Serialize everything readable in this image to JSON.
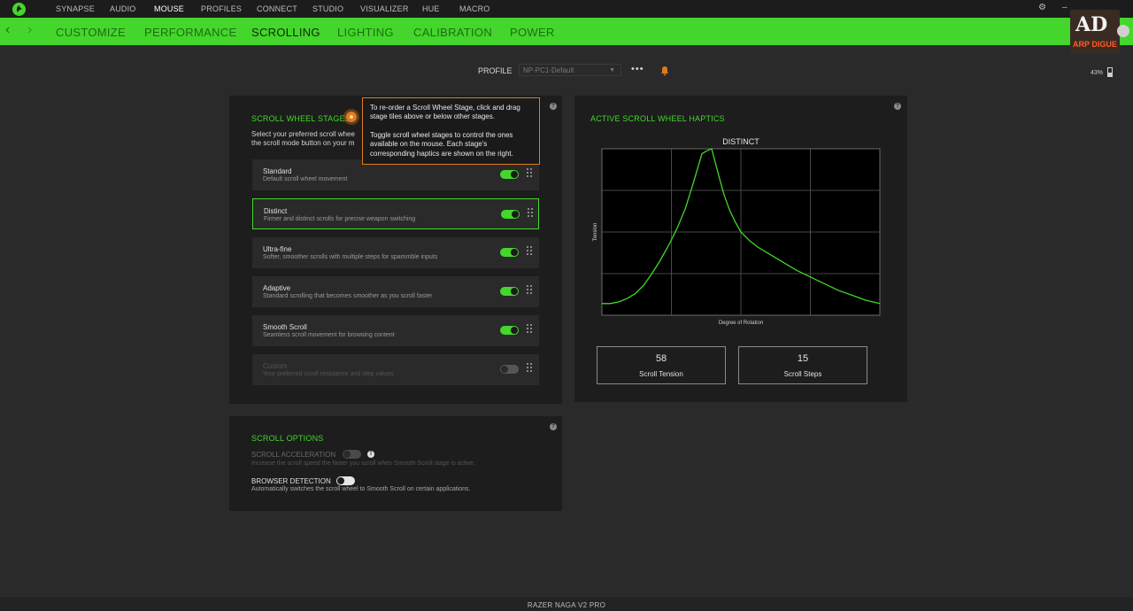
{
  "topnav": {
    "items": [
      {
        "label": "SYNAPSE"
      },
      {
        "label": "AUDIO"
      },
      {
        "label": "MOUSE"
      },
      {
        "label": "PROFILES"
      },
      {
        "label": "CONNECT"
      },
      {
        "label": "STUDIO"
      },
      {
        "label": "VISUALIZER"
      },
      {
        "label": "HUE"
      },
      {
        "label": "MACRO"
      }
    ],
    "active": "MOUSE"
  },
  "subnav": {
    "items": [
      {
        "label": "CUSTOMIZE"
      },
      {
        "label": "PERFORMANCE"
      },
      {
        "label": "SCROLLING"
      },
      {
        "label": "LIGHTING"
      },
      {
        "label": "CALIBRATION"
      },
      {
        "label": "POWER"
      }
    ],
    "active": "SCROLLING"
  },
  "watermark": {
    "big": "AD",
    "small": "ARP DIGUE"
  },
  "profile": {
    "label": "PROFILE",
    "value": "NP-PC1-Default",
    "more": "•••"
  },
  "battery": {
    "percent": "43%"
  },
  "stages_panel": {
    "title": "SCROLL WHEEL STAGES",
    "description_line1": "Select your preferred scroll whee",
    "description_line2": "the scroll mode button on your m",
    "stages": [
      {
        "name": "Standard",
        "sub": "Default scroll wheel movement",
        "enabled": true
      },
      {
        "name": "Distinct",
        "sub": "Firmer and distinct scrolls for precise weapon switching",
        "enabled": true
      },
      {
        "name": "Ultra-fine",
        "sub": "Softer, smoother scrolls with multiple steps for spammble inputs",
        "enabled": true
      },
      {
        "name": "Adaptive",
        "sub": "Standard scrolling that becomes smoother as you scroll faster",
        "enabled": true
      },
      {
        "name": "Smooth Scroll",
        "sub": "Seamless scroll movement for browsing content",
        "enabled": true
      },
      {
        "name": "Custom",
        "sub": "Your preferred scroll resistance and step values",
        "enabled": false
      }
    ]
  },
  "tooltip": {
    "para1": "To re-order a Scroll Wheel Stage, click and drag stage tiles above or below other stages.",
    "para2": "Toggle scroll wheel stages to control the ones available on the mouse. Each stage's corresponding haptics are shown on the right."
  },
  "haptics_panel": {
    "title": "ACTIVE SCROLL WHEEL HAPTICS",
    "chart_title": "DISTINCT",
    "tension": {
      "value": "58",
      "label": "Scroll Tension"
    },
    "steps": {
      "value": "15",
      "label": "Scroll Steps"
    }
  },
  "chart_data": {
    "type": "line",
    "title": "DISTINCT",
    "xlabel": "Degree of Rotation",
    "ylabel": "Tension",
    "grid": true,
    "xlim": [
      0,
      100
    ],
    "ylim": [
      0,
      100
    ],
    "series": [
      {
        "x": [
          0,
          3,
          6,
          9,
          12,
          15,
          18,
          21,
          24,
          27,
          30,
          33,
          36,
          38,
          39.5,
          42,
          44,
          46,
          48,
          50,
          53,
          56,
          60,
          65,
          70,
          75,
          80,
          85,
          90,
          95,
          100
        ],
        "y": [
          7,
          7,
          8,
          10,
          13,
          18,
          25,
          33,
          42,
          52,
          64,
          80,
          97,
          99,
          100,
          84,
          72,
          63,
          56,
          50,
          45,
          41,
          37,
          32,
          27,
          23,
          19,
          15,
          12,
          9,
          7
        ]
      }
    ],
    "colors": {
      "line": "#44d62c",
      "background": "#000000",
      "grid": "#5a5a5a"
    }
  },
  "scroll_options": {
    "title": "SCROLL OPTIONS",
    "acceleration": {
      "label": "SCROLL ACCELERATION",
      "sub": "Increase the scroll speed the faster you scroll when Smooth Scroll stage is active.",
      "enabled": false
    },
    "browser_detection": {
      "label": "BROWSER DETECTION",
      "sub": "Automatically switches the scroll wheel to Smooth Scroll on certain applications.",
      "enabled": false
    }
  },
  "footer": {
    "device": "RAZER NAGA V2 PRO"
  },
  "colors": {
    "accent": "#44d62c",
    "tooltip_border": "#e07b1e",
    "panel": "#1d1d1d",
    "background": "#2a2a2a"
  }
}
